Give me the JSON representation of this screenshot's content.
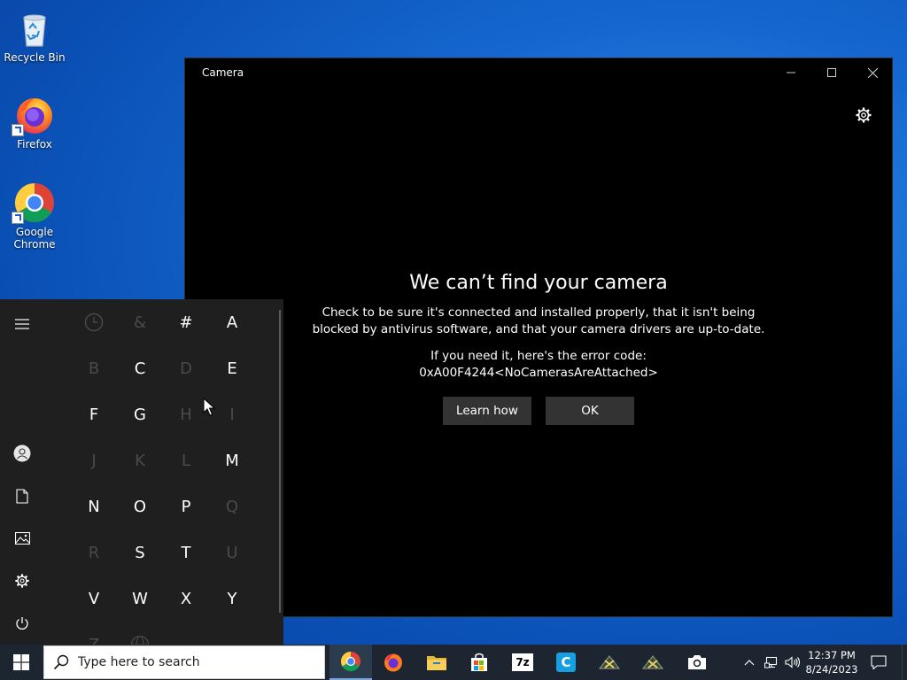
{
  "desktop": {
    "icons": [
      {
        "label": "Recycle Bin"
      },
      {
        "label": "Firefox"
      },
      {
        "label": "Google Chrome"
      }
    ]
  },
  "camera_window": {
    "title": "Camera",
    "heading": "We can’t find your camera",
    "message": "Check to be sure it's connected and installed properly, that it isn't being blocked by antivirus software, and that your camera drivers are up-to-date.",
    "error_intro": "If you need it, here's the error code:",
    "error_code": "0xA00F4244<NoCamerasAreAttached>",
    "learn_button": "Learn how",
    "ok_button": "OK",
    "icons": [
      "minimize-icon",
      "maximize-icon",
      "close-icon",
      "gear-icon"
    ]
  },
  "start_menu": {
    "rail_icons": [
      "hamburger-icon",
      "user-icon",
      "document-icon",
      "pictures-icon",
      "gear-icon",
      "power-icon"
    ],
    "letters": [
      {
        "label": "",
        "enabled": false,
        "icon": "clock-icon"
      },
      {
        "label": "&",
        "enabled": false
      },
      {
        "label": "#",
        "enabled": true
      },
      {
        "label": "A",
        "enabled": true
      },
      {
        "label": "B",
        "enabled": false
      },
      {
        "label": "C",
        "enabled": true
      },
      {
        "label": "D",
        "enabled": false
      },
      {
        "label": "E",
        "enabled": true
      },
      {
        "label": "F",
        "enabled": true
      },
      {
        "label": "G",
        "enabled": true
      },
      {
        "label": "H",
        "enabled": false
      },
      {
        "label": "I",
        "enabled": false
      },
      {
        "label": "J",
        "enabled": false
      },
      {
        "label": "K",
        "enabled": false
      },
      {
        "label": "L",
        "enabled": false
      },
      {
        "label": "M",
        "enabled": true
      },
      {
        "label": "N",
        "enabled": true
      },
      {
        "label": "O",
        "enabled": true
      },
      {
        "label": "P",
        "enabled": true
      },
      {
        "label": "Q",
        "enabled": false
      },
      {
        "label": "R",
        "enabled": false
      },
      {
        "label": "S",
        "enabled": true
      },
      {
        "label": "T",
        "enabled": true
      },
      {
        "label": "U",
        "enabled": false
      },
      {
        "label": "V",
        "enabled": true
      },
      {
        "label": "W",
        "enabled": true
      },
      {
        "label": "X",
        "enabled": true
      },
      {
        "label": "Y",
        "enabled": true
      },
      {
        "label": "Z",
        "enabled": false
      },
      {
        "label": "",
        "enabled": false,
        "icon": "globe-icon"
      }
    ]
  },
  "taskbar": {
    "search_placeholder": "Type here to search",
    "apps": [
      "chrome-icon",
      "firefox-icon",
      "file-explorer-icon",
      "store-icon",
      "7zip-icon",
      "ccleaner-icon",
      "app-icon",
      "app-icon",
      "camera-icon"
    ],
    "seven_zip_label": "7z",
    "ccleaner_label": "C",
    "tray_icons": [
      "chevron-up-icon",
      "network-icon",
      "volume-icon"
    ],
    "time": "12:37 PM",
    "date": "8/24/2023",
    "notifications_icon": "notification-icon"
  }
}
